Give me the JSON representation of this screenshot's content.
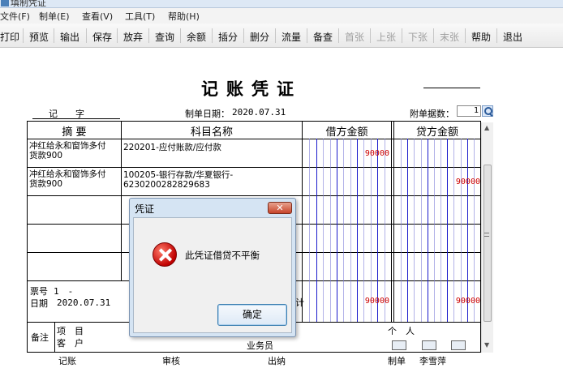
{
  "window": {
    "title": "填制凭证"
  },
  "menu": [
    "文件(F)",
    "制单(E)",
    "查看(V)",
    "工具(T)",
    "帮助(H)"
  ],
  "toolbar": {
    "buttons": [
      {
        "label": "打印",
        "enabled": true
      },
      {
        "label": "预览",
        "enabled": true
      },
      {
        "label": "输出",
        "enabled": true
      },
      {
        "label": "保存",
        "enabled": true
      },
      {
        "label": "放弃",
        "enabled": true
      },
      {
        "label": "查询",
        "enabled": true
      },
      {
        "label": "余额",
        "enabled": true
      },
      {
        "label": "插分",
        "enabled": true
      },
      {
        "label": "删分",
        "enabled": true
      },
      {
        "label": "流量",
        "enabled": true
      },
      {
        "label": "备查",
        "enabled": true
      },
      {
        "label": "首张",
        "enabled": false
      },
      {
        "label": "上张",
        "enabled": false
      },
      {
        "label": "下张",
        "enabled": false
      },
      {
        "label": "末张",
        "enabled": false
      },
      {
        "label": "帮助",
        "enabled": true
      },
      {
        "label": "退出",
        "enabled": true
      }
    ]
  },
  "voucher": {
    "title": "记账凭证",
    "type_label": "记　　字",
    "date_label": "制单日期：",
    "date": "2020.07.31",
    "attachments_label": "附单据数：",
    "attachments": "1",
    "headers": {
      "summary": "摘 要",
      "account": "科目名称",
      "debit": "借方金额",
      "credit": "贷方金额"
    },
    "rows": [
      {
        "summary": "冲红给永和窗饰多付\n货款900",
        "account": "220201-应付账款/应付款",
        "debit": "90000",
        "credit": ""
      },
      {
        "summary": "冲红给永和窗饰多付\n货款900",
        "account": "100205-银行存款/华夏银行-\n6230200282829683",
        "debit": "",
        "credit": "90000"
      }
    ],
    "ticket_no_label": "票号",
    "ticket_no": "1　-",
    "footer_date_label": "日期",
    "footer_date": "2020.07.31",
    "total_label": "计",
    "total_debit": "90000",
    "total_credit": "90000",
    "remark_label": "备注",
    "project_label": "项　目",
    "customer_label": "客　户",
    "person_label": "个　人",
    "salesperson_label": "业务员",
    "bookkeeper_label": "记账",
    "auditor_label": "审核",
    "cashier_label": "出纳",
    "maker_label": "制单",
    "maker_name": "李雪萍"
  },
  "dialog": {
    "title": "凭证",
    "close_label": "✕",
    "message": "此凭证借贷不平衡",
    "ok_label": "确定"
  }
}
